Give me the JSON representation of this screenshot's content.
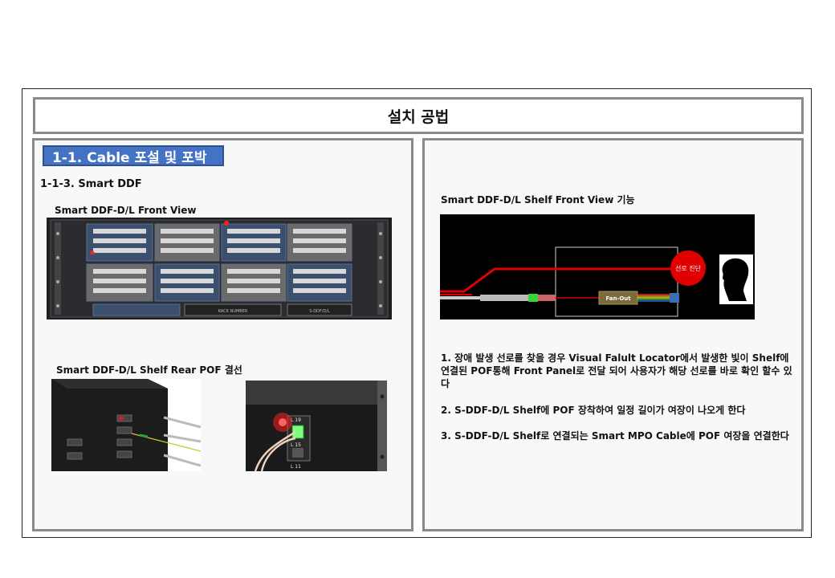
{
  "slide": {
    "title": "설치 공법",
    "section_tag": "1-1. Cable 포설 및 포박",
    "subsection": "1-1-3. Smart DDF",
    "front_view_caption": "Smart DDF-D/L Front View",
    "rear_caption": "Smart DDF-D/L Shelf Rear POF 결선",
    "function_caption": "Smart DDF-D/L Shelf Front View 기능",
    "diagram": {
      "cut_label": "선로 진단",
      "fanout_label": "Fan-Out"
    },
    "front_panel_labels": {
      "module_label": "RACK NUMBER",
      "serial_label": "S-DDF/D/L"
    },
    "rear_port_labels": [
      "L 19",
      "L 15",
      "L 11"
    ],
    "notes": [
      "1. 장애 발생 선로를 찾을 경우 Visual Falult Locator에서 발생한 빛이 Shelf에 연결된 POF통해 Front Panel로 전달 되어 사용자가 해당 선로를 바로 확인 할수 있다",
      "2. S-DDF-D/L Shelf에 POF 장착하여 일정 길이가 여장이 나오게 한다",
      "3. S-DDF-D/L Shelf로 연결되는 Smart MPO Cable에 POF 여장을 연결한다"
    ]
  },
  "colors": {
    "accent_blue": "#4472c4",
    "border_gray": "#8a8a8a",
    "laser_red": "#e00000"
  }
}
